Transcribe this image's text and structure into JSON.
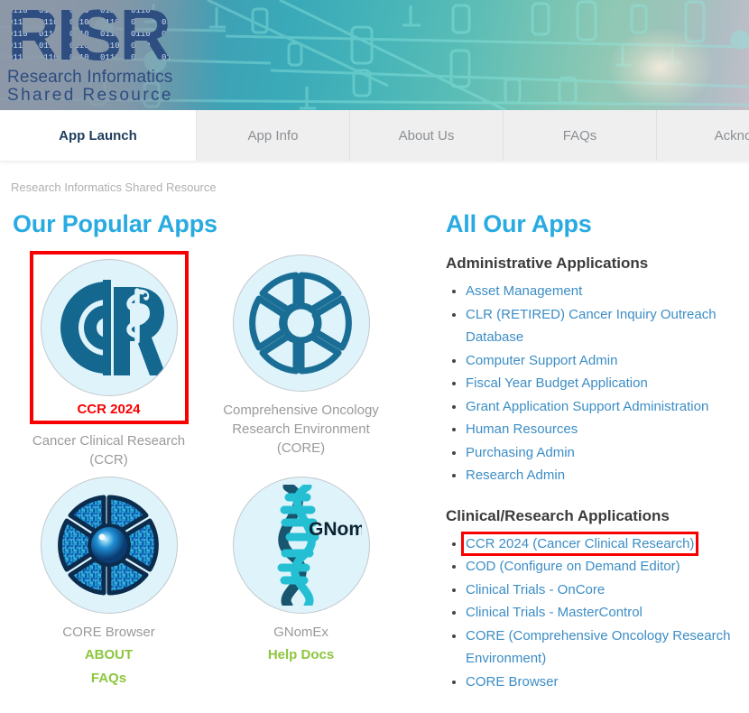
{
  "banner": {
    "logo_title": "RISR",
    "logo_subtitle_line1": "Research Informatics",
    "logo_subtitle_line2": "Shared Resource"
  },
  "tabs": [
    {
      "label": "App Launch",
      "active": true
    },
    {
      "label": "App Info",
      "active": false
    },
    {
      "label": "About Us",
      "active": false
    },
    {
      "label": "FAQs",
      "active": false
    },
    {
      "label": "Ackno",
      "active": false
    }
  ],
  "breadcrumb": "Research Informatics Shared Resource",
  "popular": {
    "heading": "Our Popular Apps",
    "apps": [
      {
        "icon": "ccr-caduceus-icon",
        "tile_label": "CCR 2024",
        "caption": "Cancer Clinical Research (CCR)",
        "highlighted": true,
        "links": []
      },
      {
        "icon": "core-wheel-icon",
        "tile_label": "",
        "caption": "Comprehensive Oncology Research Environment (CORE)",
        "highlighted": false,
        "links": []
      },
      {
        "icon": "core-browser-circuit-wheel-icon",
        "tile_label": "",
        "caption": "CORE Browser",
        "highlighted": false,
        "links": [
          "ABOUT",
          "FAQs"
        ]
      },
      {
        "icon": "gnomex-dna-icon",
        "tile_label": "",
        "caption": "GNomEx",
        "highlighted": false,
        "links": [
          "Help Docs"
        ]
      }
    ]
  },
  "all_apps": {
    "heading": "All Our Apps",
    "groups": [
      {
        "title": "Administrative Applications",
        "items": [
          {
            "label": "Asset Management",
            "highlighted": false
          },
          {
            "label": "CLR (RETIRED) Cancer Inquiry Outreach Database",
            "highlighted": false
          },
          {
            "label": "Computer Support Admin",
            "highlighted": false
          },
          {
            "label": "Fiscal Year Budget Application",
            "highlighted": false
          },
          {
            "label": "Grant Application Support Administration",
            "highlighted": false
          },
          {
            "label": "Human Resources",
            "highlighted": false
          },
          {
            "label": "Purchasing Admin",
            "highlighted": false
          },
          {
            "label": "Research Admin",
            "highlighted": false
          }
        ]
      },
      {
        "title": "Clinical/Research Applications",
        "items": [
          {
            "label": "CCR 2024 (Cancer Clinical Research)",
            "highlighted": true
          },
          {
            "label": "COD (Configure on Demand Editor)",
            "highlighted": false
          },
          {
            "label": "Clinical Trials - OnCore",
            "highlighted": false
          },
          {
            "label": "Clinical Trials - MasterControl",
            "highlighted": false
          },
          {
            "label": "CORE (Comprehensive Oncology Research Environment)",
            "highlighted": false
          },
          {
            "label": "CORE Browser",
            "highlighted": false
          }
        ]
      }
    ]
  },
  "colors": {
    "heading_blue": "#29ABE2",
    "link_blue": "#3C8DC5",
    "highlight_red": "#f80000",
    "green_link": "#8DC63F",
    "caption_gray": "#9a9a9a",
    "icon_teal": "#14688F"
  }
}
